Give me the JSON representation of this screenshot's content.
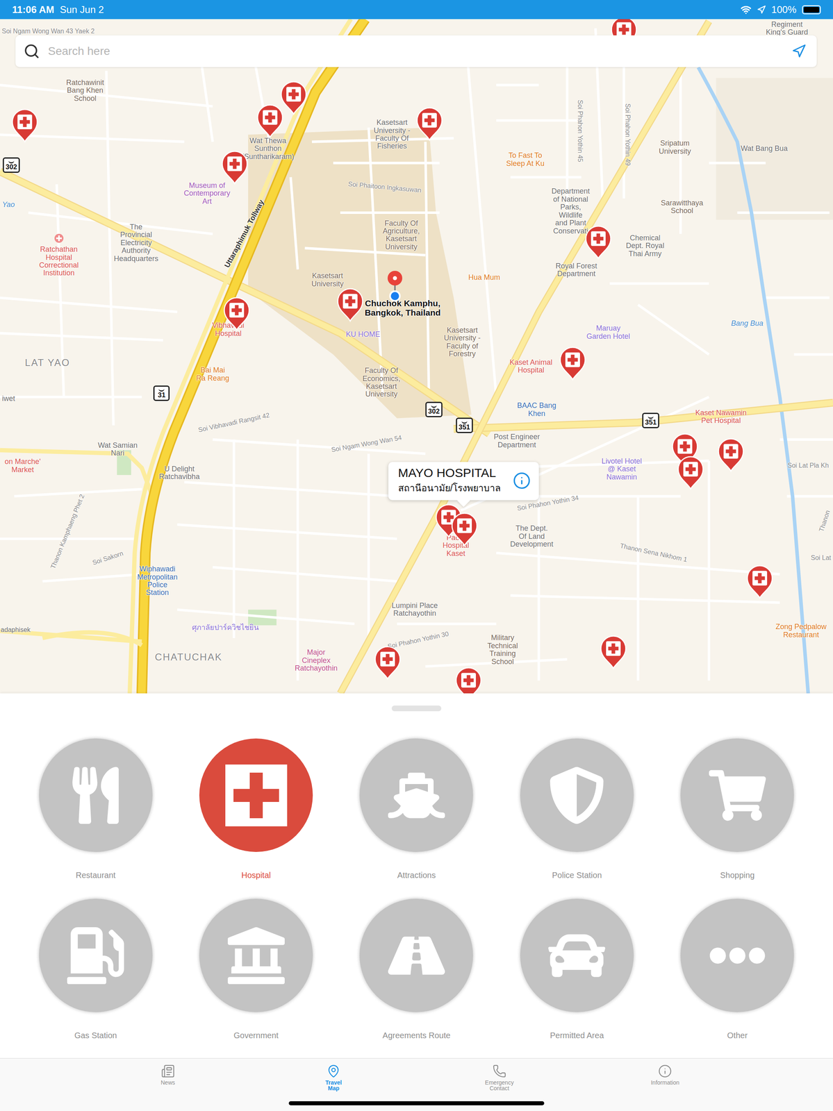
{
  "status_bar": {
    "time": "11:06 AM",
    "date": "Sun Jun 2",
    "battery": "100%",
    "battery_level": 1
  },
  "search": {
    "placeholder": "Search here"
  },
  "map": {
    "labels": [
      {
        "lines": [
          "Soi Ngam Wong Wan 43 Yaek 2"
        ],
        "kind": "road",
        "color": "#8a8a8a"
      },
      {
        "lines": [
          "Regiment",
          "King's Guard"
        ],
        "kind": "place",
        "color": "#6f6f6f"
      },
      {
        "lines": [
          "Ratchawinit",
          "Bang Khen",
          "School"
        ],
        "kind": "place",
        "color": "#7a6a5a"
      },
      {
        "lines": [
          "Wat Thewa",
          "Sunthon",
          "(Suntharikaram)"
        ],
        "kind": "place",
        "color": "#6f6f6f"
      },
      {
        "lines": [
          "Kasetsart",
          "University -",
          "Faculty Of",
          "Fisheries"
        ],
        "kind": "place",
        "color": "#6f6f6f"
      },
      {
        "lines": [
          "To Fast To",
          "Sleep At Ku"
        ],
        "kind": "place",
        "color": "#e07b22"
      },
      {
        "lines": [
          "Sripatum",
          "University"
        ],
        "kind": "place",
        "color": "#7a6a5a"
      },
      {
        "lines": [
          "Wat Bang Bua"
        ],
        "kind": "place",
        "color": "#6f6f6f"
      },
      {
        "lines": [
          "Soi Phahon Yothin 45"
        ],
        "kind": "road",
        "color": "#8a8a8a"
      },
      {
        "lines": [
          "Soi Phahon Yothin 49"
        ],
        "kind": "road",
        "color": "#8a8a8a"
      },
      {
        "lines": [
          "Museum of",
          "Contemporary",
          "Art"
        ],
        "kind": "place",
        "color": "#a259b8"
      },
      {
        "lines": [
          "Soi Phaitoon Ingkasuwan"
        ],
        "kind": "road",
        "color": "#8a8a8a"
      },
      {
        "lines": [
          "Department",
          "of National",
          "Parks,",
          "Wildlife",
          "and Plant",
          "Conservati"
        ],
        "kind": "place",
        "color": "#6f6f6f"
      },
      {
        "lines": [
          "Sarawitthaya",
          "School"
        ],
        "kind": "place",
        "color": "#7a6a5a"
      },
      {
        "lines": [
          "Yao"
        ],
        "kind": "water",
        "color": "#4a8fcf"
      },
      {
        "lines": [
          "The",
          "Provincial",
          "Electricity",
          "Authority",
          "Headquarters"
        ],
        "kind": "place",
        "color": "#6f6f6f"
      },
      {
        "lines": [
          "Ratchathan",
          "Hospital",
          "Correctional",
          "Institution"
        ],
        "kind": "place",
        "color": "#d9534f"
      },
      {
        "lines": [
          "Faculty Of",
          "Agriculture,",
          "Kasetsart",
          "University"
        ],
        "kind": "place",
        "color": "#7a6a5a"
      },
      {
        "lines": [
          "Chemical",
          "Dept. Royal",
          "Thai Army"
        ],
        "kind": "place",
        "color": "#6f6f6f"
      },
      {
        "lines": [
          "Royal Forest",
          "Department"
        ],
        "kind": "place",
        "color": "#6f6f6f"
      },
      {
        "lines": [
          "Uttaraphimuk Tollway"
        ],
        "kind": "highway",
        "color": "#333333"
      },
      {
        "lines": [
          "Kasetsart",
          "University"
        ],
        "kind": "place",
        "color": "#7a6a5a"
      },
      {
        "lines": [
          "Hua Mum"
        ],
        "kind": "place",
        "color": "#e07b22"
      },
      {
        "lines": [
          "Chuchok Kamphu,",
          "Bangkok, Thailand"
        ],
        "kind": "address",
        "color": "#111111"
      },
      {
        "lines": [
          "Vibhavadi",
          "Hospital"
        ],
        "kind": "place",
        "color": "#d9534f"
      },
      {
        "lines": [
          "KU HOME"
        ],
        "kind": "place",
        "color": "#8a6fd6"
      },
      {
        "lines": [
          "Kasetsart",
          "University -",
          "Faculty of",
          "Forestry"
        ],
        "kind": "place",
        "color": "#7a6a5a"
      },
      {
        "lines": [
          "Maruay",
          "Garden Hotel"
        ],
        "kind": "place",
        "color": "#8a6fd6"
      },
      {
        "lines": [
          "Bang Bua"
        ],
        "kind": "water",
        "color": "#4a8fcf"
      },
      {
        "lines": [
          "LAT YAO"
        ],
        "kind": "district",
        "color": "#8a8a8a"
      },
      {
        "lines": [
          "Kaset Animal",
          "Hospital"
        ],
        "kind": "place",
        "color": "#d9534f"
      },
      {
        "lines": [
          "Faculty Of",
          "Economics,",
          "Kasetsart",
          "University"
        ],
        "kind": "place",
        "color": "#7a6a5a"
      },
      {
        "lines": [
          "Bai Mai",
          "Ra Reang"
        ],
        "kind": "place",
        "color": "#e07b22"
      },
      {
        "lines": [
          "BAAC Bang",
          "Khen"
        ],
        "kind": "place",
        "color": "#3b6fb5"
      },
      {
        "lines": [
          "Kaset Nawamin",
          "Pet Hospital"
        ],
        "kind": "place",
        "color": "#d9534f"
      },
      {
        "lines": [
          "iwet"
        ],
        "kind": "place",
        "color": "#6f6f6f"
      },
      {
        "lines": [
          "Soi Vibhavadi Rangsit 42"
        ],
        "kind": "road",
        "color": "#8a8a8a"
      },
      {
        "lines": [
          "Wat Samian",
          "Nari"
        ],
        "kind": "place",
        "color": "#6f6f6f"
      },
      {
        "lines": [
          "Soi Ngam Wong Wan 54"
        ],
        "kind": "road",
        "color": "#8a8a8a"
      },
      {
        "lines": [
          "Post Engineer",
          "Department"
        ],
        "kind": "place",
        "color": "#6f6f6f"
      },
      {
        "lines": [
          "Livotel Hotel",
          "@ Kaset",
          "Nawamin"
        ],
        "kind": "place",
        "color": "#8a6fd6"
      },
      {
        "lines": [
          "Soi Lat Pla Kh"
        ],
        "kind": "road",
        "color": "#8a8a8a"
      },
      {
        "lines": [
          "on Marche'",
          "Market"
        ],
        "kind": "place",
        "color": "#d9534f"
      },
      {
        "lines": [
          "U Delight",
          "Ratchavibha"
        ],
        "kind": "place",
        "color": "#6f6f6f"
      },
      {
        "lines": [
          "Soi Phahon Yothin 34"
        ],
        "kind": "road",
        "color": "#8a8a8a"
      },
      {
        "lines": [
          "Paolo",
          "Hospital",
          "Kaset"
        ],
        "kind": "place",
        "color": "#d9534f"
      },
      {
        "lines": [
          "The Dept.",
          "Of Land",
          "Development"
        ],
        "kind": "place",
        "color": "#6f6f6f"
      },
      {
        "lines": [
          "Thanon Sena Nikhom 1"
        ],
        "kind": "road",
        "color": "#8a8a8a"
      },
      {
        "lines": [
          "Soi Sakorn"
        ],
        "kind": "road",
        "color": "#8a8a8a"
      },
      {
        "lines": [
          "Thanon Kamphaeng Phet 2"
        ],
        "kind": "road",
        "color": "#8a8a8a"
      },
      {
        "lines": [
          "Wiphawadi",
          "Metropolitan",
          "Police",
          "Station"
        ],
        "kind": "place",
        "color": "#3b6fb5"
      },
      {
        "lines": [
          "Soi Lat"
        ],
        "kind": "road",
        "color": "#8a8a8a"
      },
      {
        "lines": [
          "Zong Pedpalow",
          "Restaurant"
        ],
        "kind": "place",
        "color": "#e07b22"
      },
      {
        "lines": [
          "adaphisek"
        ],
        "kind": "road",
        "color": "#6f6f6f"
      },
      {
        "lines": [
          "ศุภาลัยปาร์ควิชไชยิน"
        ],
        "kind": "place",
        "color": "#8a6fd6"
      },
      {
        "lines": [
          "Lumpini Place",
          "Ratchayothin"
        ],
        "kind": "place",
        "color": "#6f6f6f"
      },
      {
        "lines": [
          "Soi Phahon Yothin 30"
        ],
        "kind": "road",
        "color": "#8a8a8a"
      },
      {
        "lines": [
          "Military",
          "Technical",
          "Training",
          "School"
        ],
        "kind": "place",
        "color": "#7a6a5a"
      },
      {
        "lines": [
          "CHATUCHAK"
        ],
        "kind": "district",
        "color": "#8a8a8a"
      },
      {
        "lines": [
          "Major",
          "Cineplex",
          "Ratchayothin"
        ],
        "kind": "place",
        "color": "#c0508a"
      },
      {
        "lines": [
          "Thanon"
        ],
        "kind": "road",
        "color": "#8a8a8a"
      }
    ],
    "route_shields": [
      "302",
      "31",
      "302",
      "351",
      "351"
    ],
    "callout": {
      "title": "MAYO HOSPITAL",
      "subtitle": "สถานีอนามัย/โรงพยาบาล"
    }
  },
  "categories": [
    {
      "label": "Restaurant",
      "selected": false
    },
    {
      "label": "Hospital",
      "selected": true
    },
    {
      "label": "Attractions",
      "selected": false
    },
    {
      "label": "Police Station",
      "selected": false
    },
    {
      "label": "Shopping",
      "selected": false
    },
    {
      "label": "Gas Station",
      "selected": false
    },
    {
      "label": "Government",
      "selected": false
    },
    {
      "label": "Agreements Route",
      "selected": false
    },
    {
      "label": "Permitted Area",
      "selected": false
    },
    {
      "label": "Other",
      "selected": false
    }
  ],
  "tabs": [
    {
      "label": "News",
      "selected": false
    },
    {
      "label": "Travel Map",
      "selected": true
    },
    {
      "label": "Emergency Contact",
      "selected": false
    },
    {
      "label": "Information",
      "selected": false
    }
  ]
}
